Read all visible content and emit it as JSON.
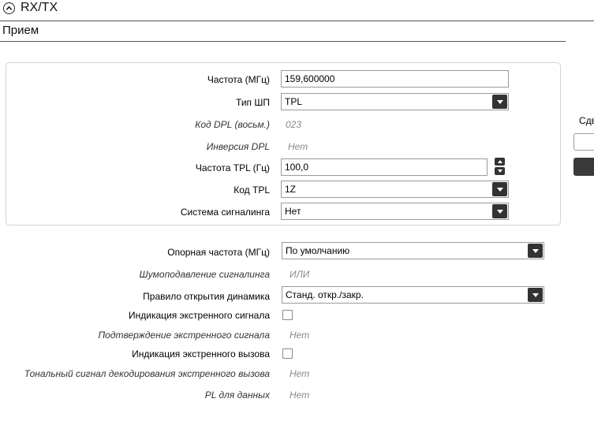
{
  "header": {
    "title": "RX/TX"
  },
  "subheader": {
    "title": "Прием"
  },
  "panel": {
    "frequency_label": "Частота (МГц)",
    "frequency_value": "159,600000",
    "shp_type_label": "Тип ШП",
    "shp_type_value": "TPL",
    "dpl_code_label": "Код DPL (восьм.)",
    "dpl_code_value": "023",
    "dpl_inversion_label": "Инверсия DPL",
    "dpl_inversion_value": "Нет",
    "tpl_freq_label": "Частота TPL (Гц)",
    "tpl_freq_value": "100,0",
    "tpl_code_label": "Код TPL",
    "tpl_code_value": "1Z",
    "signaling_system_label": "Система сигналинга",
    "signaling_system_value": "Нет"
  },
  "lower": {
    "ref_freq_label": "Опорная частота (МГц)",
    "ref_freq_value": "По умолчанию",
    "signaling_squelch_label": "Шумоподавление сигналинга",
    "signaling_squelch_value": "ИЛИ",
    "speaker_rule_label": "Правило открытия динамика",
    "speaker_rule_value": "Станд. откр./закр.",
    "emergency_indication_label": "Индикация экстренного сигнала",
    "emergency_ack_label": "Подтверждение экстренного сигнала",
    "emergency_ack_value": "Нет",
    "emergency_call_indication_label": "Индикация экстренного вызова",
    "emergency_tone_label": "Тональный сигнал декодирования экстренного вызова",
    "emergency_tone_value": "Нет",
    "pl_data_label": "PL для данных",
    "pl_data_value": "Нет"
  },
  "side": {
    "shift_label": "Сдв"
  }
}
